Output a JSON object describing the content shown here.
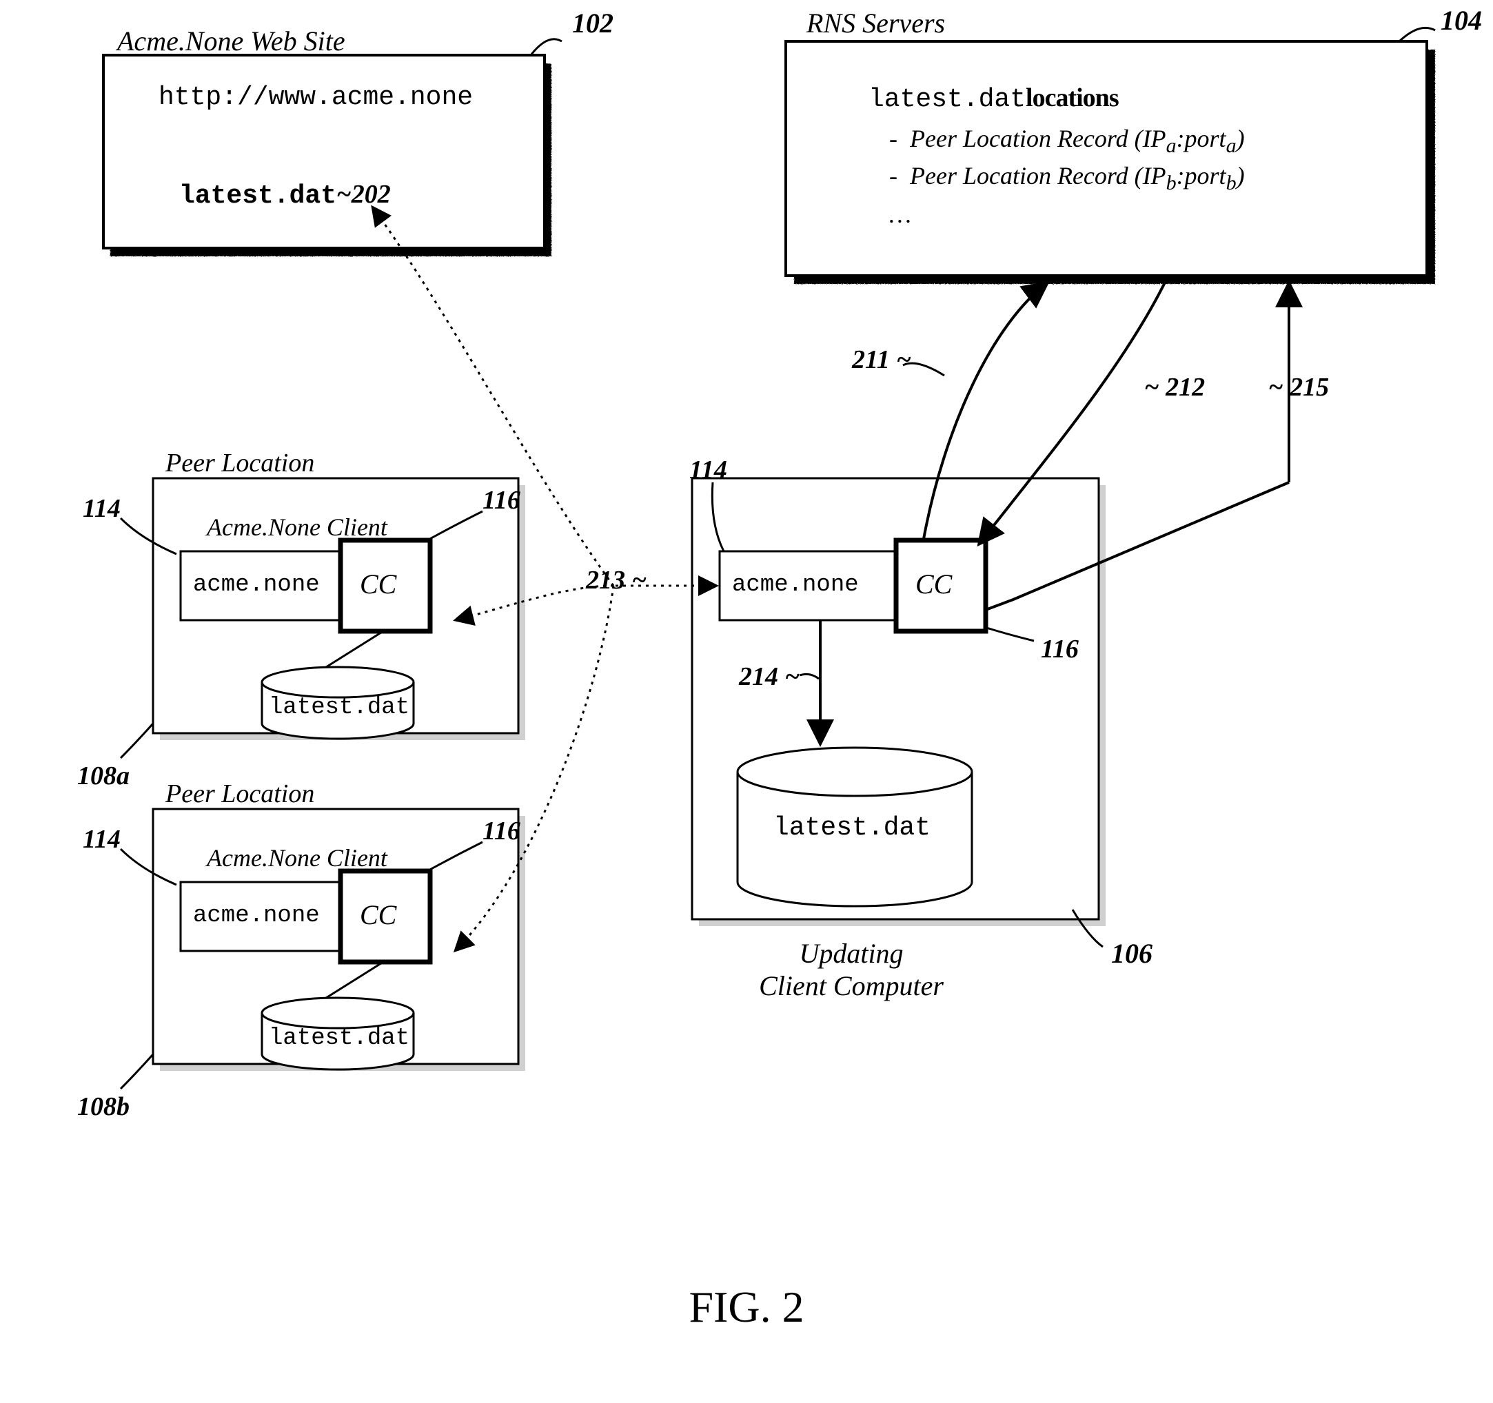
{
  "figure_label": "FIG. 2",
  "website": {
    "title": "Acme.None Web Site",
    "url": "http://www.acme.none",
    "file": "latest.dat",
    "file_ref": "~202",
    "ref": "102"
  },
  "rns": {
    "title": "RNS Servers",
    "file": "latest.dat",
    "locations_label": "locations",
    "items": [
      "Peer Location Record (IP",
      "Peer Location Record (IP"
    ],
    "item_suffix_a": "a",
    "item_suffix_b": "b",
    "item_sub_a": "a",
    "item_sub_b": "b",
    "port_segment": ":port",
    "close_paren": ")",
    "ellipsis": "…",
    "ref": "104"
  },
  "peer_a": {
    "title": "Peer Location",
    "subtitle": "Acme.None Client",
    "app": "acme.none",
    "cc": "CC",
    "file": "latest.dat",
    "ref114": "114",
    "ref116": "116",
    "ref108": "108a"
  },
  "peer_b": {
    "title": "Peer Location",
    "subtitle": "Acme.None Client",
    "app": "acme.none",
    "cc": "CC",
    "file": "latest.dat",
    "ref114": "114",
    "ref116": "116",
    "ref108": "108b"
  },
  "client": {
    "title": "Updating\nClient Computer",
    "app": "acme.none",
    "cc": "CC",
    "file": "latest.dat",
    "ref114": "114",
    "ref116": "116",
    "ref106": "106"
  },
  "arrows": {
    "r211": "211",
    "r212": "~ 212",
    "r213": "213 ~",
    "r214": "214",
    "r215": "~ 215",
    "tilde211": "~"
  }
}
